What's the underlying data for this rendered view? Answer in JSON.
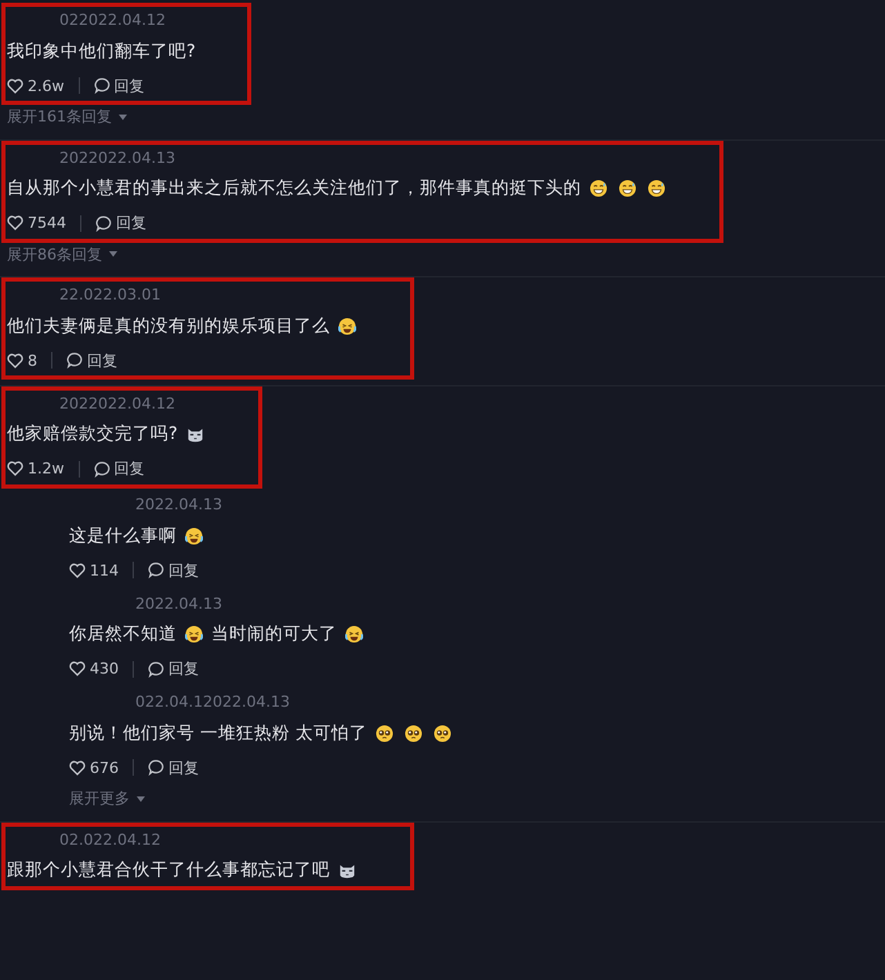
{
  "comments": [
    {
      "date": "022022.04.12",
      "highlighted": true,
      "segments": [
        {
          "kind": "text",
          "text": "我印象中他们翻车了吧?"
        }
      ],
      "likes": "2.6w",
      "reply_label": "回复",
      "expand": "展开161条回复"
    },
    {
      "date": "2022022.04.13",
      "highlighted": true,
      "segments": [
        {
          "kind": "text",
          "text": "自从那个小慧君的事出来之后就不怎么关注他们了，那件事真的挺下头的"
        },
        {
          "kind": "grin"
        },
        {
          "kind": "grin"
        },
        {
          "kind": "grin"
        }
      ],
      "likes": "7544",
      "reply_label": "回复",
      "expand": "展开86条回复"
    },
    {
      "date": "22.022.03.01",
      "highlighted": true,
      "segments": [
        {
          "kind": "text",
          "text": "他们夫妻俩是真的没有别的娱乐项目了么"
        },
        {
          "kind": "laughcry"
        }
      ],
      "likes": "8",
      "reply_label": "回复"
    },
    {
      "date": "2022022.04.12",
      "highlighted": true,
      "segments": [
        {
          "kind": "text",
          "text": "他家赔偿款交完了吗?"
        },
        {
          "kind": "cat"
        }
      ],
      "likes": "1.2w",
      "reply_label": "回复",
      "expand": "展开更多",
      "replies": [
        {
          "date": "2022.04.13",
          "segments": [
            {
              "kind": "text",
              "text": "这是什么事啊"
            },
            {
              "kind": "laughcry"
            }
          ],
          "likes": "114",
          "reply_label": "回复"
        },
        {
          "date": "2022.04.13",
          "segments": [
            {
              "kind": "text",
              "text": "你居然不知道"
            },
            {
              "kind": "laughcry"
            },
            {
              "kind": "text",
              "text": "当时闹的可大了"
            },
            {
              "kind": "laughcry"
            }
          ],
          "likes": "430",
          "reply_label": "回复"
        },
        {
          "date": "022.04.12022.04.13",
          "segments": [
            {
              "kind": "text",
              "text": "别说！他们家号 一堆狂热粉 太可怕了"
            },
            {
              "kind": "pleading"
            },
            {
              "kind": "pleading"
            },
            {
              "kind": "pleading"
            }
          ],
          "likes": "676",
          "reply_label": "回复"
        }
      ]
    },
    {
      "date": "02.022.04.12",
      "highlighted": true,
      "segments": [
        {
          "kind": "text",
          "text": "跟那个小慧君合伙干了什么事都忘记了吧"
        },
        {
          "kind": "cat"
        }
      ]
    }
  ]
}
